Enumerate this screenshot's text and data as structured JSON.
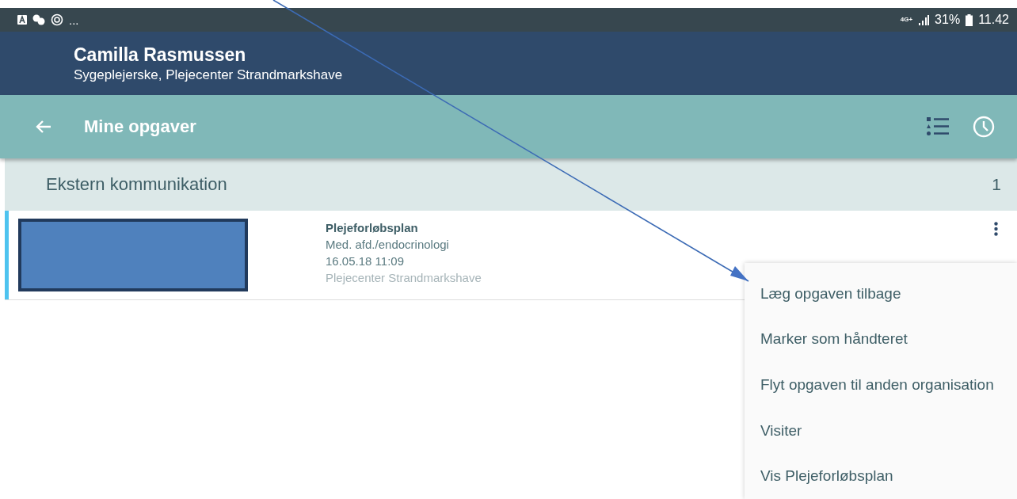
{
  "status_bar": {
    "more": "...",
    "network": "4G+",
    "battery": "31%",
    "time": "11.42"
  },
  "header": {
    "name": "Camilla Rasmussen",
    "role": "Sygeplejerske, Plejecenter Strandmarkshave"
  },
  "toolbar": {
    "title": "Mine opgaver"
  },
  "section": {
    "title": "Ekstern kommunikation",
    "count": "1"
  },
  "tasks": [
    {
      "title": "Plejeforløbsplan",
      "department": "Med. afd./endocrinologi",
      "date": "16.05.18 11:09",
      "location": "Plejecenter Strandmarkshave"
    }
  ],
  "menu": [
    {
      "label": "Læg opgaven tilbage"
    },
    {
      "label": "Marker som håndteret"
    },
    {
      "label": "Flyt opgaven til anden organisation"
    },
    {
      "label": "Visiter"
    },
    {
      "label": "Vis Plejeforløbsplan"
    }
  ]
}
